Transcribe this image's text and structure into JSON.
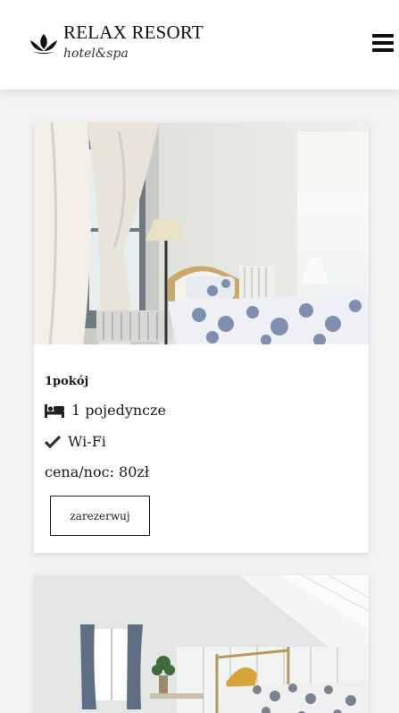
{
  "header": {
    "brand": "RELAX RESORT",
    "tagline": "hotel&spa",
    "logo_icon": "lotus-icon",
    "menu_icon": "hamburger-menu-icon"
  },
  "rooms": [
    {
      "title": "1pokój",
      "beds_icon": "bed-icon",
      "beds": "1 pojedyncze",
      "wifi_icon": "check-icon",
      "wifi": "Wi-Fi",
      "price": "cena/noc: 80zł",
      "book_label": "zarezerwuj"
    }
  ],
  "colors": {
    "background": "#f3f3f3",
    "card": "#ffffff",
    "text": "#1a1a1a"
  }
}
